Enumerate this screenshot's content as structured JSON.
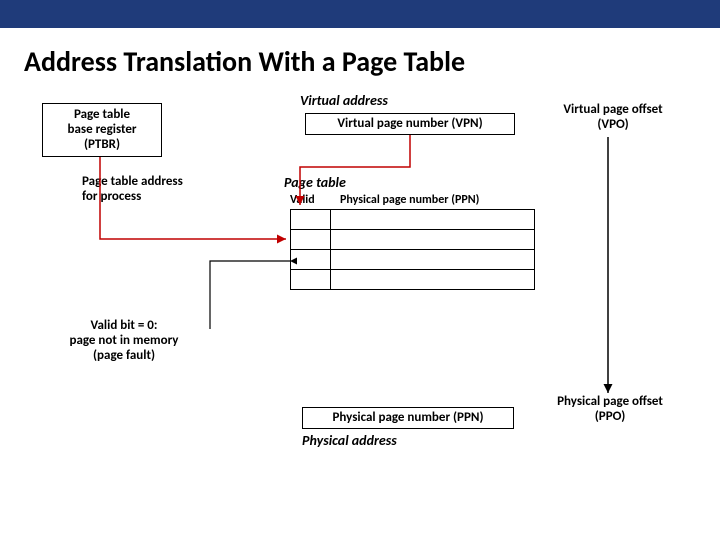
{
  "title": "Address Translation With a Page Table",
  "ptbr": {
    "line1": "Page table",
    "line2": "base register",
    "line3": "(PTBR)"
  },
  "virtual_address_label": "Virtual address",
  "vpn_label": "Virtual page number (VPN)",
  "vpo": {
    "line1": "Virtual page offset",
    "line2": "(VPO)"
  },
  "pt_addr": {
    "line1": "Page table address",
    "line2": "for process"
  },
  "page_table_label": "Page table",
  "table_headers": {
    "valid": "Valid",
    "ppn": "Physical page number (PPN)"
  },
  "fault": {
    "line1": "Valid bit = 0:",
    "line2": "page not in memory",
    "line3": "(page fault)"
  },
  "ppn_label": "Physical page number (PPN)",
  "ppo": {
    "line1": "Physical page offset",
    "line2": "(PPO)"
  },
  "physical_address_label": "Physical address"
}
